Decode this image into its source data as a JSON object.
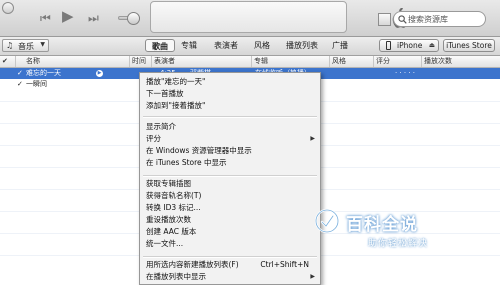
{
  "toolbar": {
    "search": {
      "placeholder": "搜索资源库"
    }
  },
  "navbar": {
    "library_select": "音乐",
    "tabs": [
      {
        "label": "歌曲",
        "active": true
      },
      {
        "label": "专辑"
      },
      {
        "label": "表演者"
      },
      {
        "label": "风格"
      },
      {
        "label": "播放列表"
      },
      {
        "label": "广播"
      }
    ],
    "device_button": "iPhone",
    "store_button": "iTunes Store"
  },
  "columns": {
    "name": "名称",
    "time": "时间",
    "artist": "表演者",
    "album": "专辑",
    "genre": "风格",
    "rating": "评分",
    "plays": "播放次数"
  },
  "songs": [
    {
      "checked": "✓",
      "name": "难忘的一天",
      "time": "4:25",
      "artist": "邓紫棋",
      "album": "在线收听（热播）",
      "rating": "· · · · ·",
      "selected": true
    },
    {
      "checked": "✓",
      "name": "一瞬间",
      "time": "",
      "artist": "",
      "album": "",
      "rating": ""
    }
  ],
  "context_menu": {
    "items": [
      {
        "label": "播放\"难忘的一天\""
      },
      {
        "label": "下一首播放"
      },
      {
        "label": "添加到\"接着播放\""
      },
      {
        "separator": true
      },
      {
        "label": "显示简介"
      },
      {
        "label": "评分",
        "submenu": true
      },
      {
        "label": "在 Windows 资源管理器中显示"
      },
      {
        "label": "在 iTunes Store 中显示"
      },
      {
        "separator": true
      },
      {
        "label": "获取专辑插图"
      },
      {
        "label": "获得音轨名称(T)"
      },
      {
        "label": "转换 ID3 标记..."
      },
      {
        "label": "重设播放次数"
      },
      {
        "label": "创建 AAC 版本"
      },
      {
        "label": "统一文件..."
      },
      {
        "separator": true
      },
      {
        "label": "用所选内容新建播放列表(F)",
        "shortcut": "Ctrl+Shift+N"
      },
      {
        "label": "在播放列表中显示",
        "submenu": true
      }
    ]
  },
  "watermark": {
    "title": "百科全说",
    "subtitle": "助你轻松解决"
  },
  "colors": {
    "selection": "#3c74cd",
    "toolbar_gradient_top": "#e9e9e9",
    "toolbar_gradient_bottom": "#cfcfcf",
    "menu_background": "#f2f2f2"
  }
}
